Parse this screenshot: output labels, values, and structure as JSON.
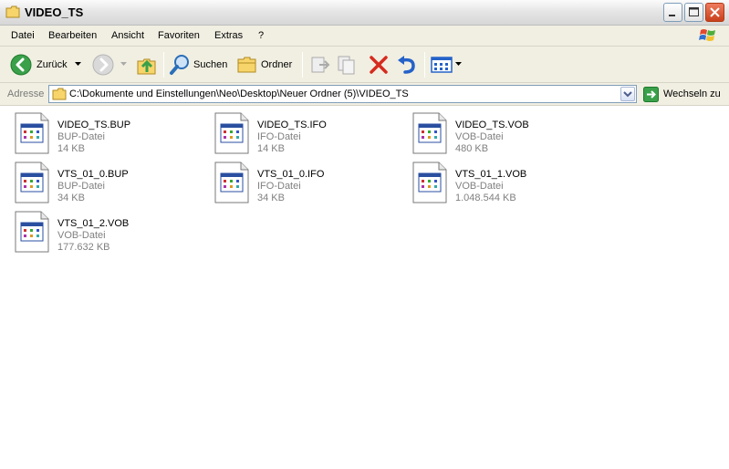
{
  "window": {
    "title": "VIDEO_TS"
  },
  "menu": [
    "Datei",
    "Bearbeiten",
    "Ansicht",
    "Favoriten",
    "Extras",
    "?"
  ],
  "toolbar": {
    "back_label": "Zurück",
    "search_label": "Suchen",
    "folders_label": "Ordner"
  },
  "address": {
    "label": "Adresse",
    "value": "C:\\Dokumente und Einstellungen\\Neo\\Desktop\\Neuer Ordner (5)\\VIDEO_TS",
    "go_label": "Wechseln zu"
  },
  "files": [
    {
      "name": "VIDEO_TS.BUP",
      "type": "BUP-Datei",
      "size": "14 KB"
    },
    {
      "name": "VIDEO_TS.IFO",
      "type": "IFO-Datei",
      "size": "14 KB"
    },
    {
      "name": "VIDEO_TS.VOB",
      "type": "VOB-Datei",
      "size": "480 KB"
    },
    {
      "name": "VTS_01_0.BUP",
      "type": "BUP-Datei",
      "size": "34 KB"
    },
    {
      "name": "VTS_01_0.IFO",
      "type": "IFO-Datei",
      "size": "34 KB"
    },
    {
      "name": "VTS_01_1.VOB",
      "type": "VOB-Datei",
      "size": "1.048.544 KB"
    },
    {
      "name": "VTS_01_2.VOB",
      "type": "VOB-Datei",
      "size": "177.632 KB"
    }
  ],
  "colors": {
    "chrome": "#f1efe2",
    "back_green": "#3aa04a",
    "delete_red": "#d52b1e",
    "undo_blue": "#2462c9"
  }
}
